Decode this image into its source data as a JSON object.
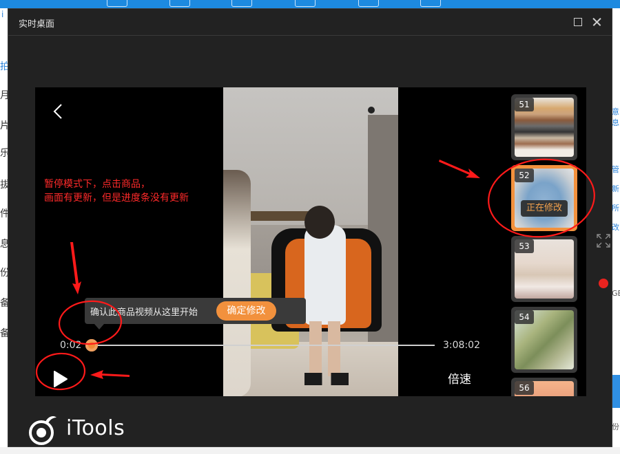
{
  "background_app": {
    "left_letters": [
      "i",
      "拍",
      "月",
      "片",
      "乐",
      "拔",
      "件",
      "息",
      "份",
      "备",
      "备"
    ],
    "right_texts": [
      "意息",
      "管",
      "新",
      "所",
      "改",
      "GB",
      "份"
    ]
  },
  "window": {
    "title": "实时桌面"
  },
  "player": {
    "tooltip_text": "确认此商品视频从这里开始",
    "confirm_label": "确定修改",
    "time_current": "0:02",
    "time_total": "3:08:02",
    "speed_label": "倍速",
    "progress_fraction": 0.0002
  },
  "annotation": {
    "line1": "暂停模式下，点击商品，",
    "line2": "画面有更新，但是进度条没有更新"
  },
  "thumbnails": [
    {
      "number": "51",
      "image": "sweaters"
    },
    {
      "number": "52",
      "image": "blue-shirt",
      "active": true,
      "badge": "正在修改"
    },
    {
      "number": "53",
      "image": "white-dress"
    },
    {
      "number": "54",
      "image": "green-dress"
    },
    {
      "number": "56",
      "image": "sunset"
    }
  ],
  "brand": {
    "logo_text": "iTools"
  },
  "colors": {
    "accent_orange": "#f2913d",
    "annotation_red": "#ff2a2a",
    "window_bg": "#222222",
    "app_blue": "#1d8ae0"
  },
  "icons": [
    "back-arrow-icon",
    "play-icon",
    "maximize-icon",
    "close-icon",
    "expand-icon",
    "record-dot-icon",
    "itools-logo-icon"
  ]
}
